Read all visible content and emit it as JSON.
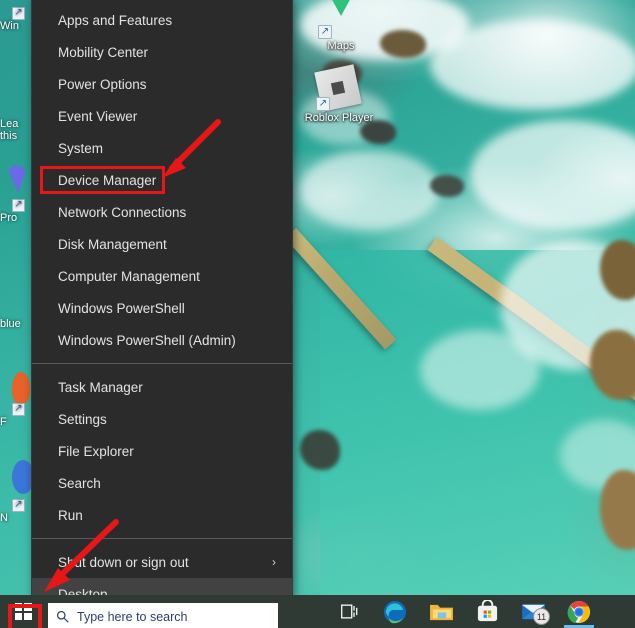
{
  "os": "Windows 10",
  "colors": {
    "menu_background": "#2b2b2b",
    "menu_text": "#e3e3e3",
    "menu_highlight": "#424242",
    "annotation_red": "#e81717",
    "taskbar_background": "#2e3a33",
    "search_text": "#2c3e70"
  },
  "power_user_menu": {
    "name": "Win+X Power User Menu",
    "groups": [
      {
        "items": [
          {
            "label": "Apps and Features",
            "highlighted": false,
            "submenu": false
          },
          {
            "label": "Mobility Center",
            "highlighted": false,
            "submenu": false
          },
          {
            "label": "Power Options",
            "highlighted": false,
            "submenu": false
          },
          {
            "label": "Event Viewer",
            "highlighted": false,
            "submenu": false
          },
          {
            "label": "System",
            "highlighted": false,
            "submenu": false
          },
          {
            "label": "Device Manager",
            "highlighted": false,
            "submenu": false,
            "annotated": true
          },
          {
            "label": "Network Connections",
            "highlighted": false,
            "submenu": false
          },
          {
            "label": "Disk Management",
            "highlighted": false,
            "submenu": false
          },
          {
            "label": "Computer Management",
            "highlighted": false,
            "submenu": false
          },
          {
            "label": "Windows PowerShell",
            "highlighted": false,
            "submenu": false
          },
          {
            "label": "Windows PowerShell (Admin)",
            "highlighted": false,
            "submenu": false
          }
        ]
      },
      {
        "items": [
          {
            "label": "Task Manager",
            "highlighted": false,
            "submenu": false
          },
          {
            "label": "Settings",
            "highlighted": false,
            "submenu": false
          },
          {
            "label": "File Explorer",
            "highlighted": false,
            "submenu": false
          },
          {
            "label": "Search",
            "highlighted": false,
            "submenu": false
          },
          {
            "label": "Run",
            "highlighted": false,
            "submenu": false
          }
        ]
      },
      {
        "items": [
          {
            "label": "Shut down or sign out",
            "highlighted": false,
            "submenu": true,
            "chevron": "›"
          },
          {
            "label": "Desktop",
            "highlighted": true,
            "submenu": false
          }
        ]
      }
    ]
  },
  "annotations": {
    "device_manager_box": {
      "target": "Device Manager",
      "color": "#e81717"
    },
    "start_button_box": {
      "target": "Start button",
      "color": "#e81717"
    },
    "arrows": [
      {
        "name": "arrow-to-device-manager",
        "color": "#e81717",
        "direction": "down-left"
      },
      {
        "name": "arrow-to-start-button",
        "color": "#e81717",
        "direction": "down-left"
      }
    ]
  },
  "desktop_icons": [
    {
      "label": "Maps",
      "icon": "maps-pin-icon",
      "shortcut": true
    },
    {
      "label": "Roblox Player",
      "icon": "roblox-icon",
      "shortcut": true
    }
  ],
  "desktop_icons_clipped": [
    {
      "label": "Win",
      "icon": "generic-shortcut-icon"
    },
    {
      "label": "Lea",
      "label2": "this",
      "icon": "text-label"
    },
    {
      "label": "Pro",
      "icon": "generic-shortcut-icon"
    },
    {
      "label": "blue",
      "icon": "text-label"
    },
    {
      "label": "F",
      "icon": "generic-shortcut-icon"
    },
    {
      "label": "N",
      "icon": "generic-shortcut-icon"
    }
  ],
  "taskbar": {
    "start_button": {
      "name": "start-button",
      "icon": "windows-logo-icon"
    },
    "search": {
      "placeholder": "Type here to search",
      "icon": "search-icon"
    },
    "buttons": [
      {
        "name": "task-view-button",
        "icon": "task-view-icon",
        "label": "Task View"
      },
      {
        "name": "edge-button",
        "icon": "edge-icon",
        "label": "Microsoft Edge"
      },
      {
        "name": "file-explorer-button",
        "icon": "folder-icon",
        "label": "File Explorer"
      },
      {
        "name": "microsoft-store-button",
        "icon": "store-icon",
        "label": "Microsoft Store"
      },
      {
        "name": "mail-button",
        "icon": "mail-icon",
        "label": "Mail",
        "badge": "11"
      },
      {
        "name": "chrome-button",
        "icon": "chrome-icon",
        "label": "Google Chrome",
        "active": true
      }
    ]
  }
}
